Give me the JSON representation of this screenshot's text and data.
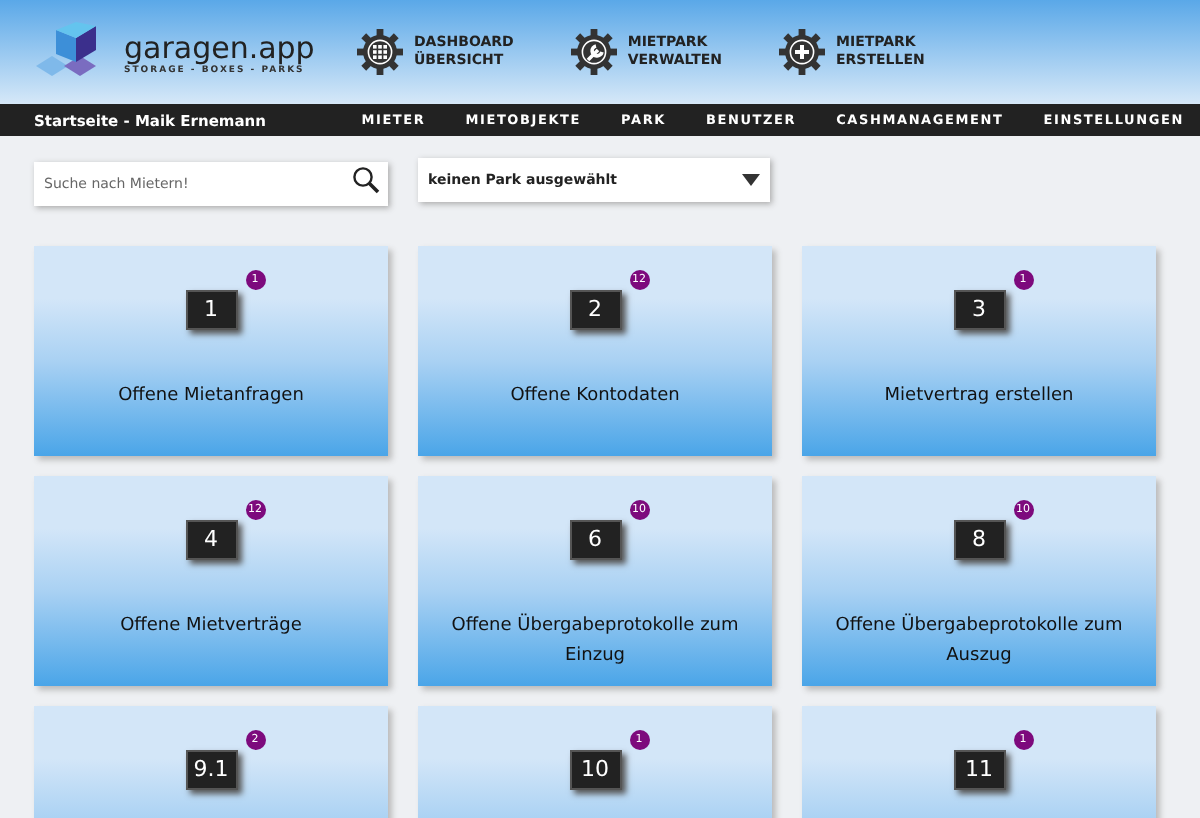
{
  "logo": {
    "name": "garagen.app",
    "tagline": "STORAGE - BOXES - PARKS"
  },
  "quick_actions": [
    {
      "kind": "grid",
      "line1": "DASHBOARD",
      "line2": "ÜBERSICHT"
    },
    {
      "kind": "wrench",
      "line1": "MIETPARK",
      "line2": "VERWALTEN"
    },
    {
      "kind": "plus",
      "line1": "MIETPARK",
      "line2": "ERSTELLEN"
    }
  ],
  "breadcrumb": "Startseite - Maik Ernemann",
  "nav": [
    "MIETER",
    "MIETOBJEKTE",
    "PARK",
    "BENUTZER",
    "CASHMANAGEMENT",
    "EINSTELLUNGEN"
  ],
  "search": {
    "placeholder": "Suche nach Mietern!"
  },
  "park_select": {
    "value": "keinen Park ausgewählt"
  },
  "tiles": [
    {
      "number": "1",
      "badge": "1",
      "label": "Offene Mietanfragen"
    },
    {
      "number": "2",
      "badge": "12",
      "label": "Offene Kontodaten"
    },
    {
      "number": "3",
      "badge": "1",
      "label": "Mietvertrag erstellen"
    },
    {
      "number": "4",
      "badge": "12",
      "label": "Offene Mietverträge"
    },
    {
      "number": "6",
      "badge": "10",
      "label": "Offene Übergabeprotokolle zum Einzug"
    },
    {
      "number": "8",
      "badge": "10",
      "label": "Offene Übergabeprotokolle zum Auszug"
    },
    {
      "number": "9.1",
      "badge": "2"
    },
    {
      "number": "10",
      "badge": "1"
    },
    {
      "number": "11",
      "badge": "1"
    }
  ]
}
